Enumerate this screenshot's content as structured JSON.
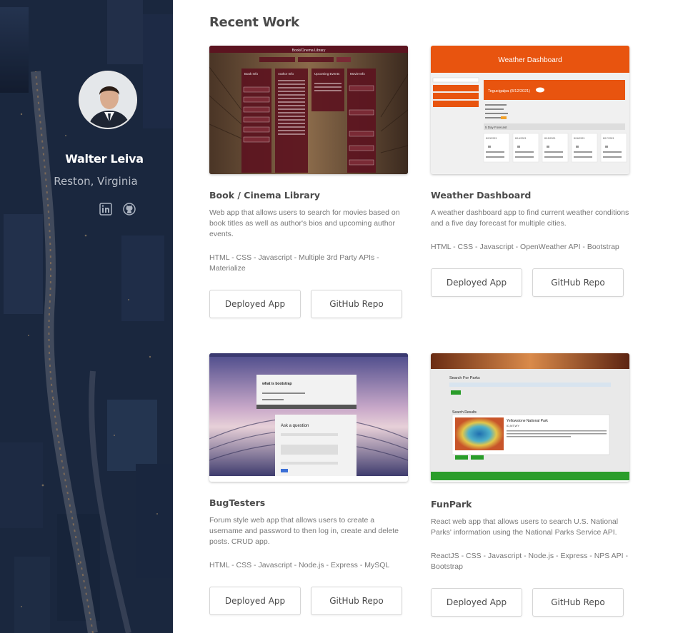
{
  "profile": {
    "name": "Walter Leiva",
    "location": "Reston, Virginia",
    "social": [
      {
        "icon": "linkedin-icon"
      },
      {
        "icon": "github-icon"
      }
    ]
  },
  "main": {
    "section_title": "Recent Work",
    "projects": [
      {
        "title": "Book / Cinema Library",
        "description": "Web app that allows users to search for movies based on book titles as well as author's bios and upcoming author events.",
        "tech": "HTML - CSS - Javascript - Multiple 3rd Party APIs - Materialize",
        "deployed_label": "Deployed App",
        "repo_label": "GitHub Repo",
        "screenshot": {
          "header": "Book/Cinema Library",
          "columns": [
            "Book Info",
            "Author Info",
            "Upcoming Events",
            "Movie Info"
          ]
        }
      },
      {
        "title": "Weather Dashboard",
        "description": "A weather dashboard app to find current weather conditions and a five day forecast for multiple cities.",
        "tech": "HTML - CSS - Javascript - OpenWeather API - Bootstrap",
        "deployed_label": "Deployed App",
        "repo_label": "GitHub Repo",
        "screenshot": {
          "header": "Weather Dashboard",
          "city": "Tegucigalpa (8/12/2021)",
          "forecast_label": "5 Day Forecast",
          "days": [
            "8/13/2021",
            "8/14/2021",
            "8/15/2021",
            "8/16/2021",
            "8/17/2021"
          ]
        }
      },
      {
        "title": "BugTesters",
        "description": "Forum style web app that allows users to create a username and password to then log in, create and delete posts. CRUD app.",
        "tech": "HTML - CSS - Javascript - Node.js - Express - MySQL",
        "deployed_label": "Deployed App",
        "repo_label": "GitHub Repo",
        "screenshot": {
          "post_title": "what is bootstrap",
          "form_title": "Ask a question"
        }
      },
      {
        "title": "FunPark",
        "description": "React web app that allows users to search U.S. National Parks' information using the National Parks Service API.",
        "tech": "ReactJS - CSS - Javascript - Node.js - Express - NPS API - Bootstrap",
        "deployed_label": "Deployed App",
        "repo_label": "GitHub Repo",
        "screenshot": {
          "search_title": "Search For Parks",
          "results_title": "Search Results",
          "park_name": "Yellowstone National Park",
          "park_states": "ID,MT,WY"
        }
      }
    ]
  },
  "colors": {
    "weather_orange": "#e8540f",
    "book_maroon": "#6b1f2a",
    "funpark_green": "#2a9d2a"
  }
}
